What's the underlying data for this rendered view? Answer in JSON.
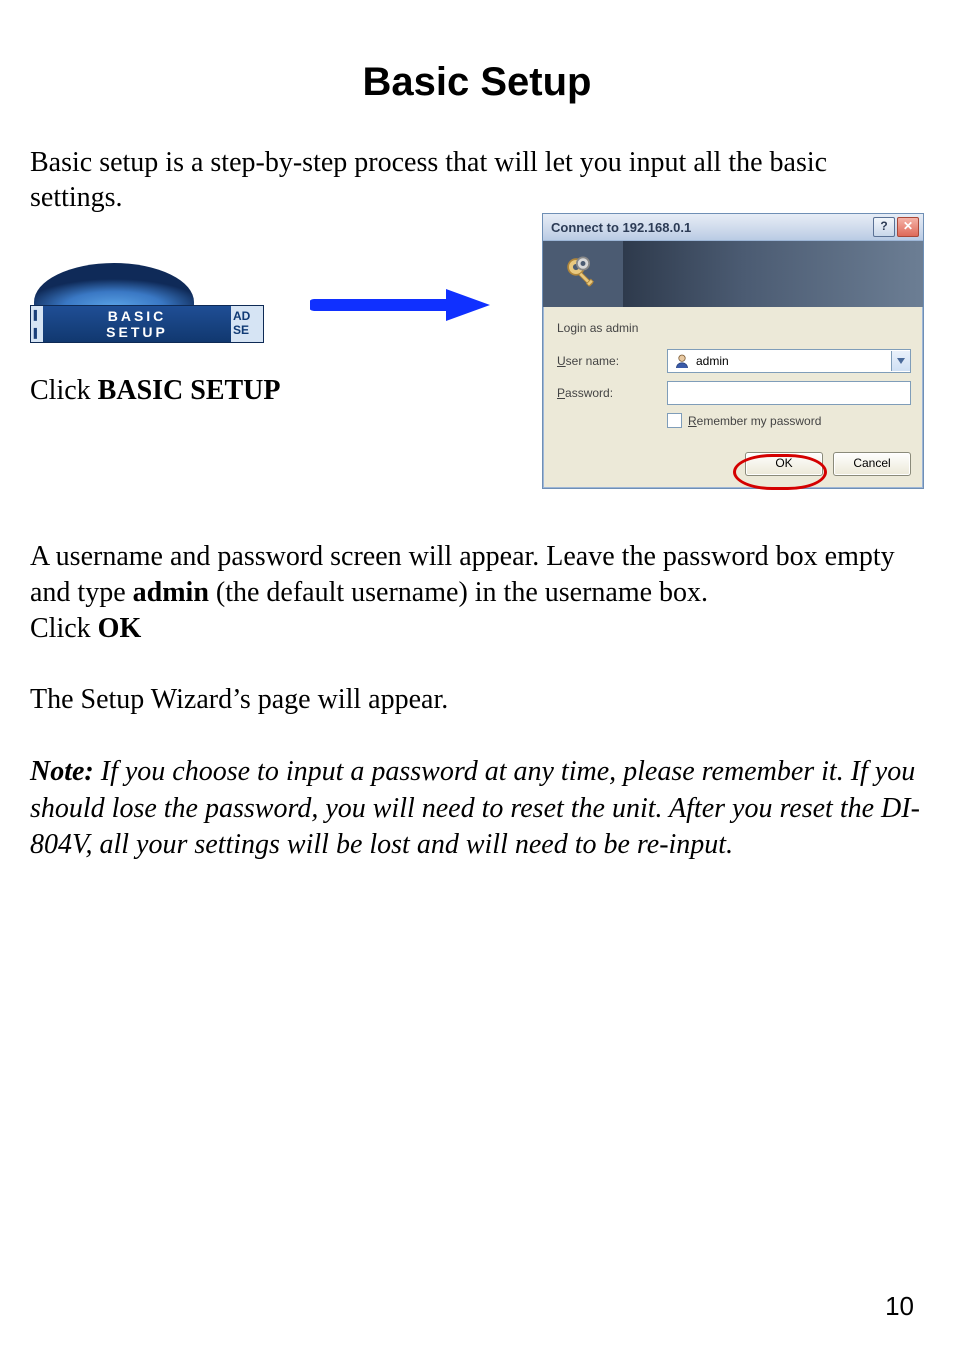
{
  "title": "Basic Setup",
  "intro": "Basic setup is a step-by-step process that will let you input all the basic settings.",
  "tab": {
    "main_line1": "BASIC",
    "main_line2": "SETUP",
    "right_line1": "AD",
    "right_line2": "SE"
  },
  "click_instruction_prefix": "Click ",
  "click_instruction_bold": "BASIC SETUP",
  "dialog": {
    "title": "Connect to 192.168.0.1",
    "help_glyph": "?",
    "close_glyph": "✕",
    "prompt": "Login as admin",
    "username_label_ul": "U",
    "username_label_rest": "ser name:",
    "username_value": "admin",
    "password_label_ul": "P",
    "password_label_rest": "assword:",
    "password_value": "",
    "remember_ul": "R",
    "remember_rest": "emember my password",
    "ok_label": "OK",
    "cancel_label": "Cancel"
  },
  "para2_a": "A username and password screen will appear. Leave the password box empty and type ",
  "para2_bold1": "admin",
  "para2_b": "  (the default username) in the username box.",
  "para2_line2_prefix": "Click ",
  "para2_line2_bold": "OK",
  "para3": "The Setup Wizard’s page will appear.",
  "note_label": "Note:",
  "note_body": "  If you choose to input a password at any time, please remember it. If you should lose the password, you will need to reset the unit.  After you reset the DI-804V, all your settings will be lost and will need to be re-input.",
  "page_number": "10"
}
